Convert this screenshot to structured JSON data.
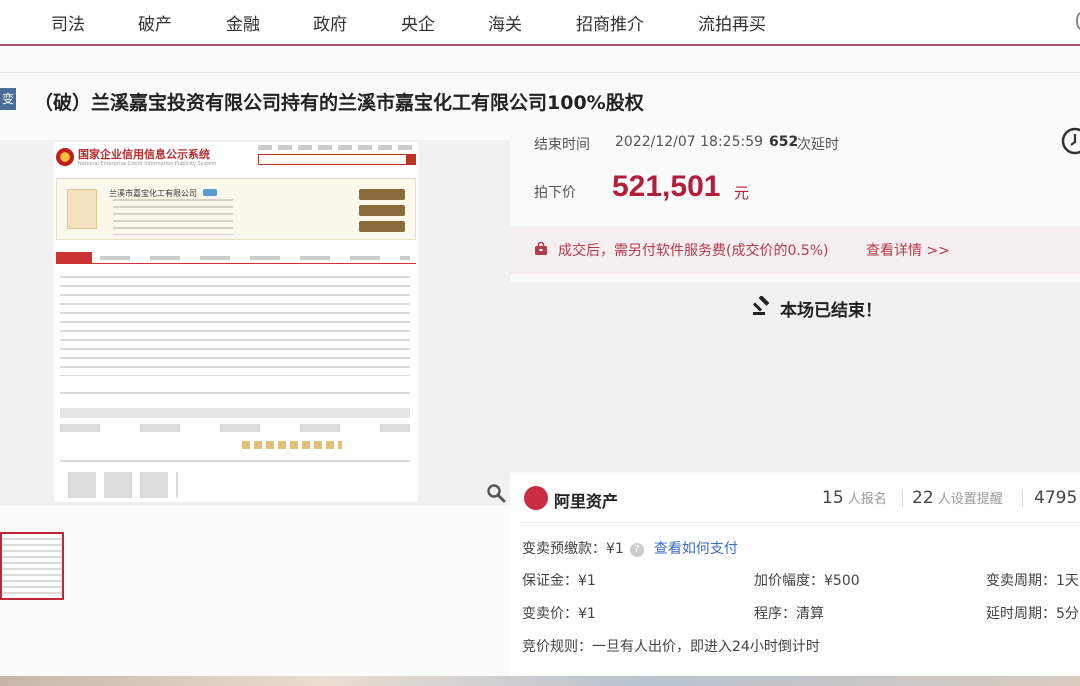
{
  "nav": {
    "items": [
      "司法",
      "破产",
      "金融",
      "政府",
      "央企",
      "海关",
      "招商推介",
      "流拍再买"
    ]
  },
  "lot": {
    "tag": "变",
    "title": "（破）兰溪嘉宝投资有限公司持有的兰溪市嘉宝化工有限公司100%股权"
  },
  "image": {
    "doc_system_name": "国家企业信用信息公示系统",
    "doc_system_en": "National Enterprise Credit Information Publicity System",
    "doc_company": "兰溪市嘉宝化工有限公司"
  },
  "auction": {
    "end_label": "结束时间",
    "end_time": "2022/12/07 18:25:59",
    "extend_count": "652",
    "extend_suffix": "次延时",
    "price_label": "拍下价",
    "price": "521,501",
    "price_unit": "元",
    "fee_text": "成交后，需另付软件服务费(成交价的0.5%)",
    "fee_link": "查看详情 >>",
    "ended_text": "本场已结束！"
  },
  "info": {
    "platform": "阿里资产",
    "signups": "15",
    "signups_label": "人报名",
    "reminders": "22",
    "reminders_label": "人设置提醒",
    "views": "4795",
    "prepay": "变卖预缴款：¥1",
    "prepay_link": "查看如何支付",
    "deposit": "保证金：¥1",
    "increment": "加价幅度：¥500",
    "period": "变卖周期：1天",
    "sale_price": "变卖价：¥1",
    "procedure": "程序：清算",
    "delay_period": "延时周期：5分",
    "rule": "竞价规则：一旦有人出价，即进入24小时倒计时"
  },
  "colors": {
    "accent": "#b31e3b",
    "link": "#3a6ec4",
    "nav_border": "#a8576a"
  }
}
